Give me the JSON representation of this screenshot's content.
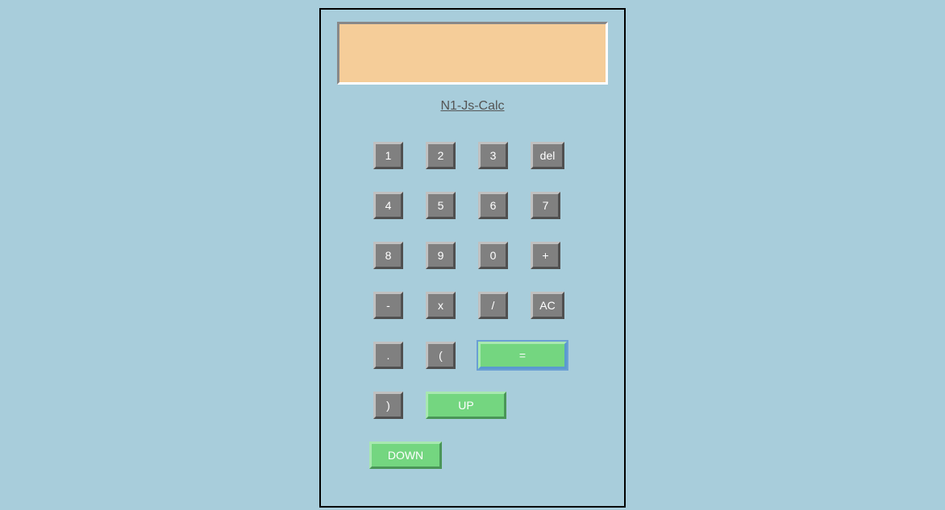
{
  "title": "N1-Js-Calc",
  "display": "",
  "buttons": {
    "row1": {
      "b1": "1",
      "b2": "2",
      "b3": "3",
      "b4": "del"
    },
    "row2": {
      "b1": "4",
      "b2": "5",
      "b3": "6",
      "b4": "7"
    },
    "row3": {
      "b1": "8",
      "b2": "9",
      "b3": "0",
      "b4": "+"
    },
    "row4": {
      "b1": "-",
      "b2": "x",
      "b3": "/",
      "b4": "AC"
    },
    "row5": {
      "b1": ".",
      "b2": "(",
      "b3": "="
    },
    "row6": {
      "b1": ")",
      "b2": "UP"
    },
    "row7": {
      "b1": "DOWN"
    }
  }
}
